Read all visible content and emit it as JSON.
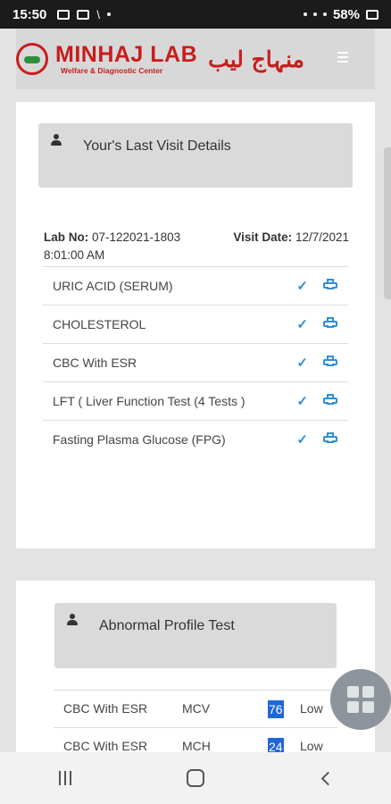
{
  "status_bar": {
    "time": "15:50",
    "battery": "58%"
  },
  "header": {
    "brand": "MINHAJ LAB",
    "tagline": "Welfare & Diagnostic Center",
    "brand_urdu": "منہاج لیب"
  },
  "last_visit": {
    "title": "Your's Last Visit Details",
    "lab_no_label": "Lab No:",
    "lab_no": "07-122021-1803",
    "visit_date_label": "Visit Date:",
    "visit_date": "12/7/2021",
    "visit_time": "8:01:00 AM",
    "tests": [
      {
        "name": "URIC ACID (SERUM)"
      },
      {
        "name": "CHOLESTEROL"
      },
      {
        "name": "CBC With ESR"
      },
      {
        "name": "LFT ( Liver Function Test (4 Tests )"
      },
      {
        "name": "Fasting Plasma Glucose (FPG)"
      }
    ]
  },
  "abnormal": {
    "title": "Abnormal Profile Test",
    "rows": [
      {
        "test": "CBC With ESR",
        "param": "MCV",
        "value": "76",
        "flag": "Low"
      },
      {
        "test": "CBC With ESR",
        "param": "MCH",
        "value": "24",
        "flag": "Low"
      }
    ]
  },
  "icons": {
    "check": "check-icon",
    "print": "print-icon",
    "user": "user-icon",
    "grid": "grid-icon"
  },
  "colors": {
    "brand_red": "#c81d1d",
    "accent_blue": "#2f8fd6",
    "highlight_blue": "#1f66d9"
  }
}
